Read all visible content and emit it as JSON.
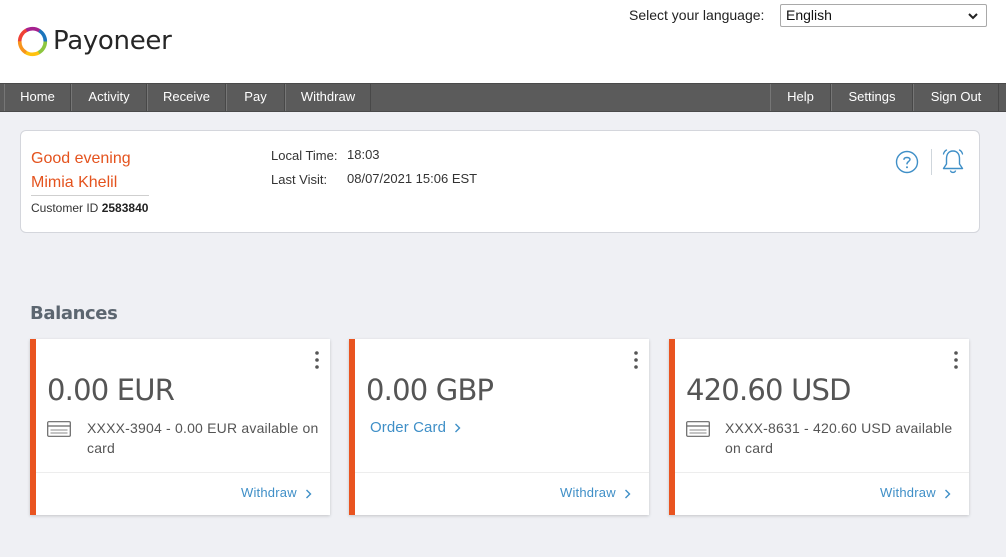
{
  "brand": {
    "name": "Payoneer",
    "colors": {
      "accent": "#e95420",
      "link": "#3f8fc7",
      "nav": "#5b5b5b"
    },
    "logo_icon": "payoneer-ring-icon"
  },
  "language": {
    "label": "Select your language:",
    "selected": "English"
  },
  "nav": {
    "left": [
      {
        "label": "Home"
      },
      {
        "label": "Activity"
      },
      {
        "label": "Receive"
      },
      {
        "label": "Pay"
      },
      {
        "label": "Withdraw"
      }
    ],
    "right": [
      {
        "label": "Help"
      },
      {
        "label": "Settings"
      },
      {
        "label": "Sign Out"
      }
    ]
  },
  "welcome": {
    "greeting": "Good evening",
    "user_name": "Mimia Khelil",
    "customer_id_label": "Customer ID",
    "customer_id": "2583840",
    "local_time_label": "Local Time:",
    "local_time": "18:03",
    "last_visit_label": "Last Visit:",
    "last_visit": "08/07/2021 15:06 EST",
    "icons": [
      "help-circle-icon",
      "bell-icon"
    ]
  },
  "balances": {
    "title": "Balances",
    "cards": [
      {
        "amount": "0.00 EUR",
        "card_text": "XXXX-3904 - 0.00 EUR available on card",
        "action": "Withdraw"
      },
      {
        "amount": "0.00 GBP",
        "order_card": "Order Card",
        "action": "Withdraw"
      },
      {
        "amount": "420.60 USD",
        "card_text": "XXXX-8631 - 420.60 USD available on card",
        "action": "Withdraw"
      }
    ]
  }
}
